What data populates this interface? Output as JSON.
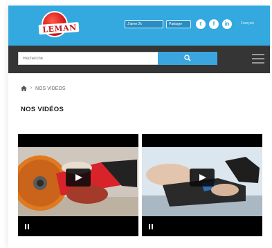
{
  "brand": {
    "logo_text": "LEMAN"
  },
  "header": {
    "fb_like_label": "J'aime 2k",
    "share_label": "Partager",
    "social": [
      {
        "name": "twitter-icon",
        "glyph": "t"
      },
      {
        "name": "facebook-icon",
        "glyph": "f"
      },
      {
        "name": "linkedin-icon",
        "glyph": "in"
      }
    ],
    "language_label": "Français",
    "colors": {
      "topbar": "#34a9e0",
      "navbar": "#353535",
      "search_button": "#3aa5de"
    }
  },
  "search": {
    "placeholder": "Recherche",
    "button_icon": "search-icon"
  },
  "menu": {
    "icon": "hamburger-menu-icon"
  },
  "breadcrumb": {
    "home_icon": "home-icon",
    "separator": ">",
    "current": "NOS VIDEOS"
  },
  "page": {
    "title": "NOS VIDÉOS"
  },
  "videos": [
    {
      "poster": "angle-grinder-cutting-disc",
      "state": "paused",
      "play_icon": "play-icon",
      "control_icon": "pause-icon"
    },
    {
      "poster": "power-tool-plunge-saw",
      "state": "paused",
      "play_icon": "play-icon",
      "control_icon": "pause-icon"
    }
  ]
}
